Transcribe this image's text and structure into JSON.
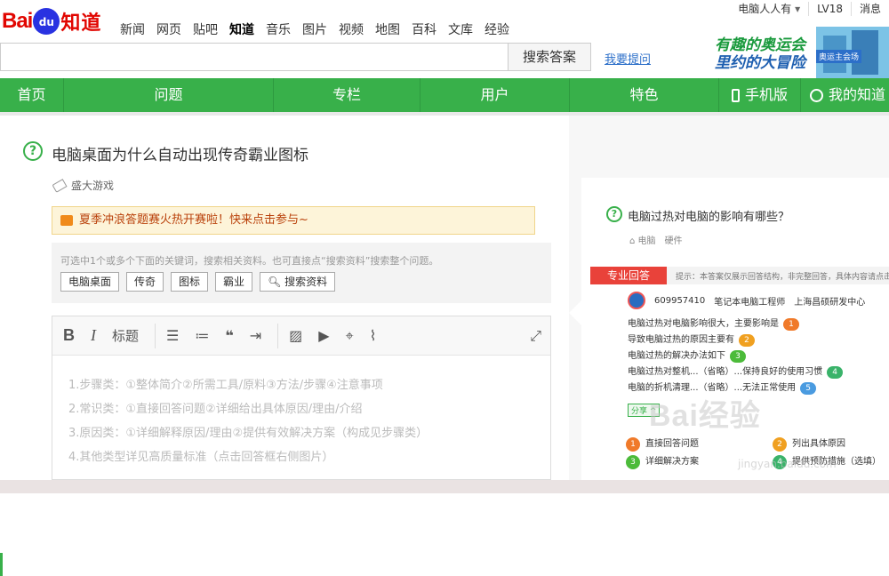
{
  "header": {
    "logo": {
      "bai": "Bai",
      "du": "du",
      "zhidao": "知道"
    },
    "nav": [
      "新闻",
      "网页",
      "贴吧",
      "知道",
      "音乐",
      "图片",
      "视频",
      "地图",
      "百科",
      "文库",
      "经验"
    ],
    "active_nav_index": 3,
    "user": {
      "name": "电脑人人有",
      "name_caret": "▾",
      "level": "LV18",
      "messages": "消息"
    },
    "search": {
      "value": "",
      "button": "搜索答案"
    },
    "ask_link": "我要提问",
    "banner": {
      "line1": "有趣的奥运会",
      "line2": "里约的大冒险",
      "tag": "奥运主会场"
    }
  },
  "mainnav": {
    "items": [
      "首页",
      "问题",
      "专栏",
      "用户",
      "特色",
      "手机版",
      "我的知道"
    ]
  },
  "question": {
    "icon": "question-circle-icon",
    "title": "电脑桌面为什么自动出现传奇霸业图标",
    "tag": "盛大游戏",
    "notice": "夏季冲浪答题赛火热开赛啦！快来点击参与~",
    "keyword_hint": "可选中1个或多个下面的关键词，搜索相关资料。也可直接点“搜索资料”搜索整个问题。",
    "keywords": [
      "电脑桌面",
      "传奇",
      "图标",
      "霸业"
    ],
    "search_material": "搜索资料"
  },
  "editor": {
    "toolbar": {
      "bold": "B",
      "italic": "I",
      "heading": "标题"
    },
    "placeholder_lines": [
      "1.步骤类：①整体简介②所需工具/原料③方法/步骤④注意事项",
      "2.常识类：①直接回答问题②详细给出具体原因/理由/介绍",
      "3.原因类：①详细解释原因/理由②提供有效解决方案（构成见步骤类）",
      "4.其他类型详见高质量标准（点击回答框右侧图片）"
    ]
  },
  "sidebar": {
    "title": "电脑过热对电脑的影响有哪些？",
    "tags": [
      "电脑",
      "硬件"
    ],
    "pro_label": "专业回答",
    "pro_hint": "提示：本答案仅展示回答结构，非完整回答，具体内容请点击右侧查看",
    "answerer": {
      "id": "609957410",
      "role": "笔记本电脑工程师",
      "org": "上海昌硕研发中心"
    },
    "answer_lines": [
      {
        "text": "电脑过热对电脑影响很大，主要影响是",
        "num": "1",
        "color": "#f07a2a"
      },
      {
        "text": "导致电脑过热的原因主要有",
        "num": "2",
        "color": "#f0a020"
      },
      {
        "text": "电脑过热的解决办法如下",
        "num": "3",
        "color": "#4cbb3a"
      },
      {
        "text": "电脑过热对整机...（省略）...保持良好的使用习惯",
        "num": "4",
        "color": "#3ab36a"
      },
      {
        "text": "电脑的折机清理...（省略）...无法正常使用",
        "num": "5",
        "color": "#4a9be0"
      }
    ],
    "share": "分享",
    "legend": [
      {
        "num": "1",
        "label": "直接回答问题",
        "color": "#f07a2a"
      },
      {
        "num": "2",
        "label": "列出具体原因",
        "color": "#f0a020"
      },
      {
        "num": "3",
        "label": "详细解决方案",
        "color": "#4cbb3a"
      },
      {
        "num": "4",
        "label": "提供预防措施（选填）",
        "color": "#3ab36a"
      }
    ]
  },
  "watermark": {
    "main": "Bai经验",
    "url": "jingyan.baidu.com"
  }
}
